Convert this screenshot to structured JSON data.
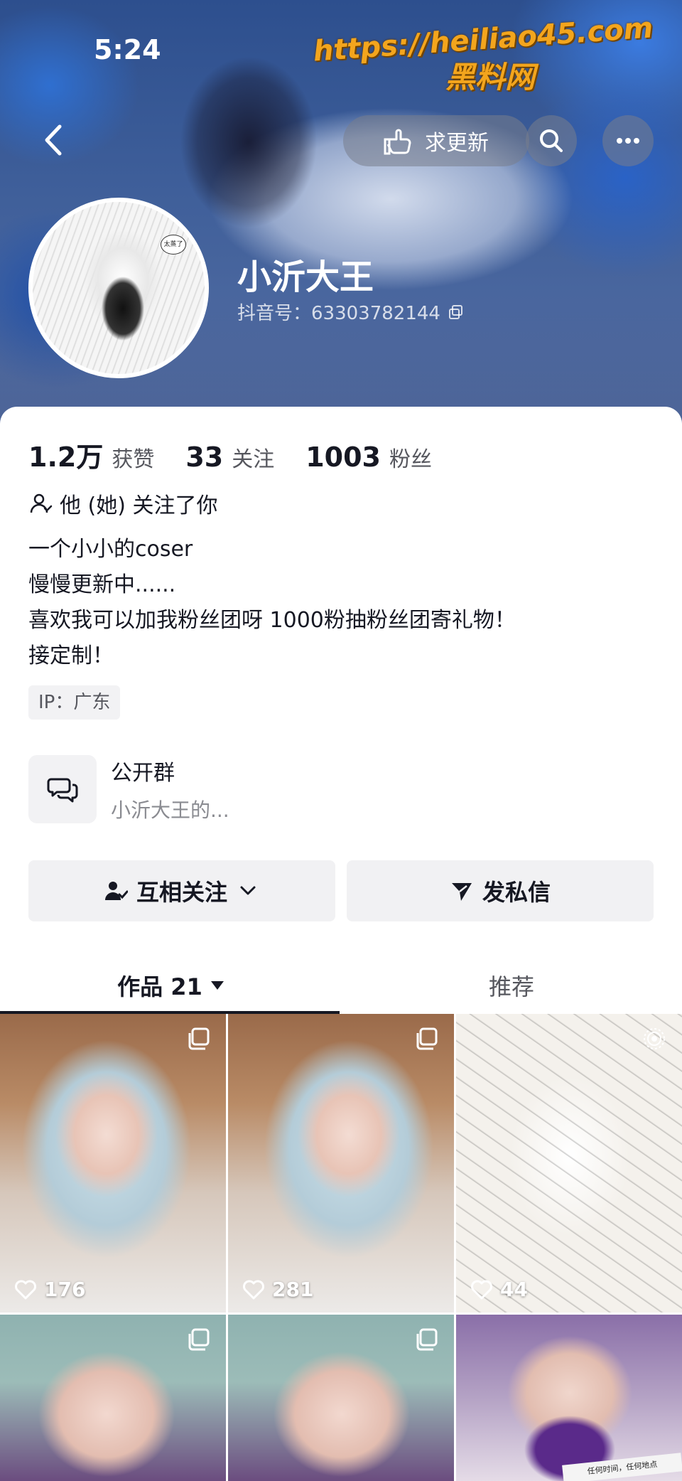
{
  "status_bar": {
    "time": "5:24"
  },
  "watermark": {
    "url": "https://heiliao45.com",
    "name": "黑料网"
  },
  "header": {
    "request_update_label": "求更新",
    "icons": {
      "back": "back-chevron-icon",
      "pointing_hand": "pointing-hand-icon",
      "search": "search-icon",
      "more": "more-dots-icon"
    }
  },
  "profile": {
    "avatar_text": "太蒸了",
    "nickname": "小沂大王",
    "douyin_id": "抖音号：63303782144"
  },
  "stats": [
    {
      "value": "1.2万",
      "label": "获赞"
    },
    {
      "value": "33",
      "label": "关注"
    },
    {
      "value": "1003",
      "label": "粉丝"
    }
  ],
  "follow_status": "他 (她) 关注了你",
  "bio": [
    "一个小小的coser",
    "慢慢更新中......",
    "喜欢我可以加我粉丝团呀 1000粉抽粉丝团寄礼物！",
    "接定制！"
  ],
  "ip_tag": "IP：广东",
  "group": {
    "title": "公开群",
    "subtitle": "小沂大王的..."
  },
  "actions": {
    "mutual_follow": "互相关注",
    "message": "发私信"
  },
  "tabs": {
    "works_label": "作品 21",
    "recommend_label": "推荐"
  },
  "grid": [
    {
      "likes": "176",
      "badge": "copy-icon"
    },
    {
      "likes": "281",
      "badge": "copy-icon"
    },
    {
      "likes": "44",
      "badge": "live-photo-icon"
    },
    {
      "likes": "",
      "badge": "copy-icon"
    },
    {
      "likes": "",
      "badge": "copy-icon"
    },
    {
      "likes": "",
      "badge": "",
      "caption": "任何时间，任何地点"
    }
  ],
  "colors": {
    "watermark": "#f3a51d",
    "text_primary": "#161823",
    "text_secondary": "#56575e",
    "button_bg": "#f1f1f3"
  }
}
